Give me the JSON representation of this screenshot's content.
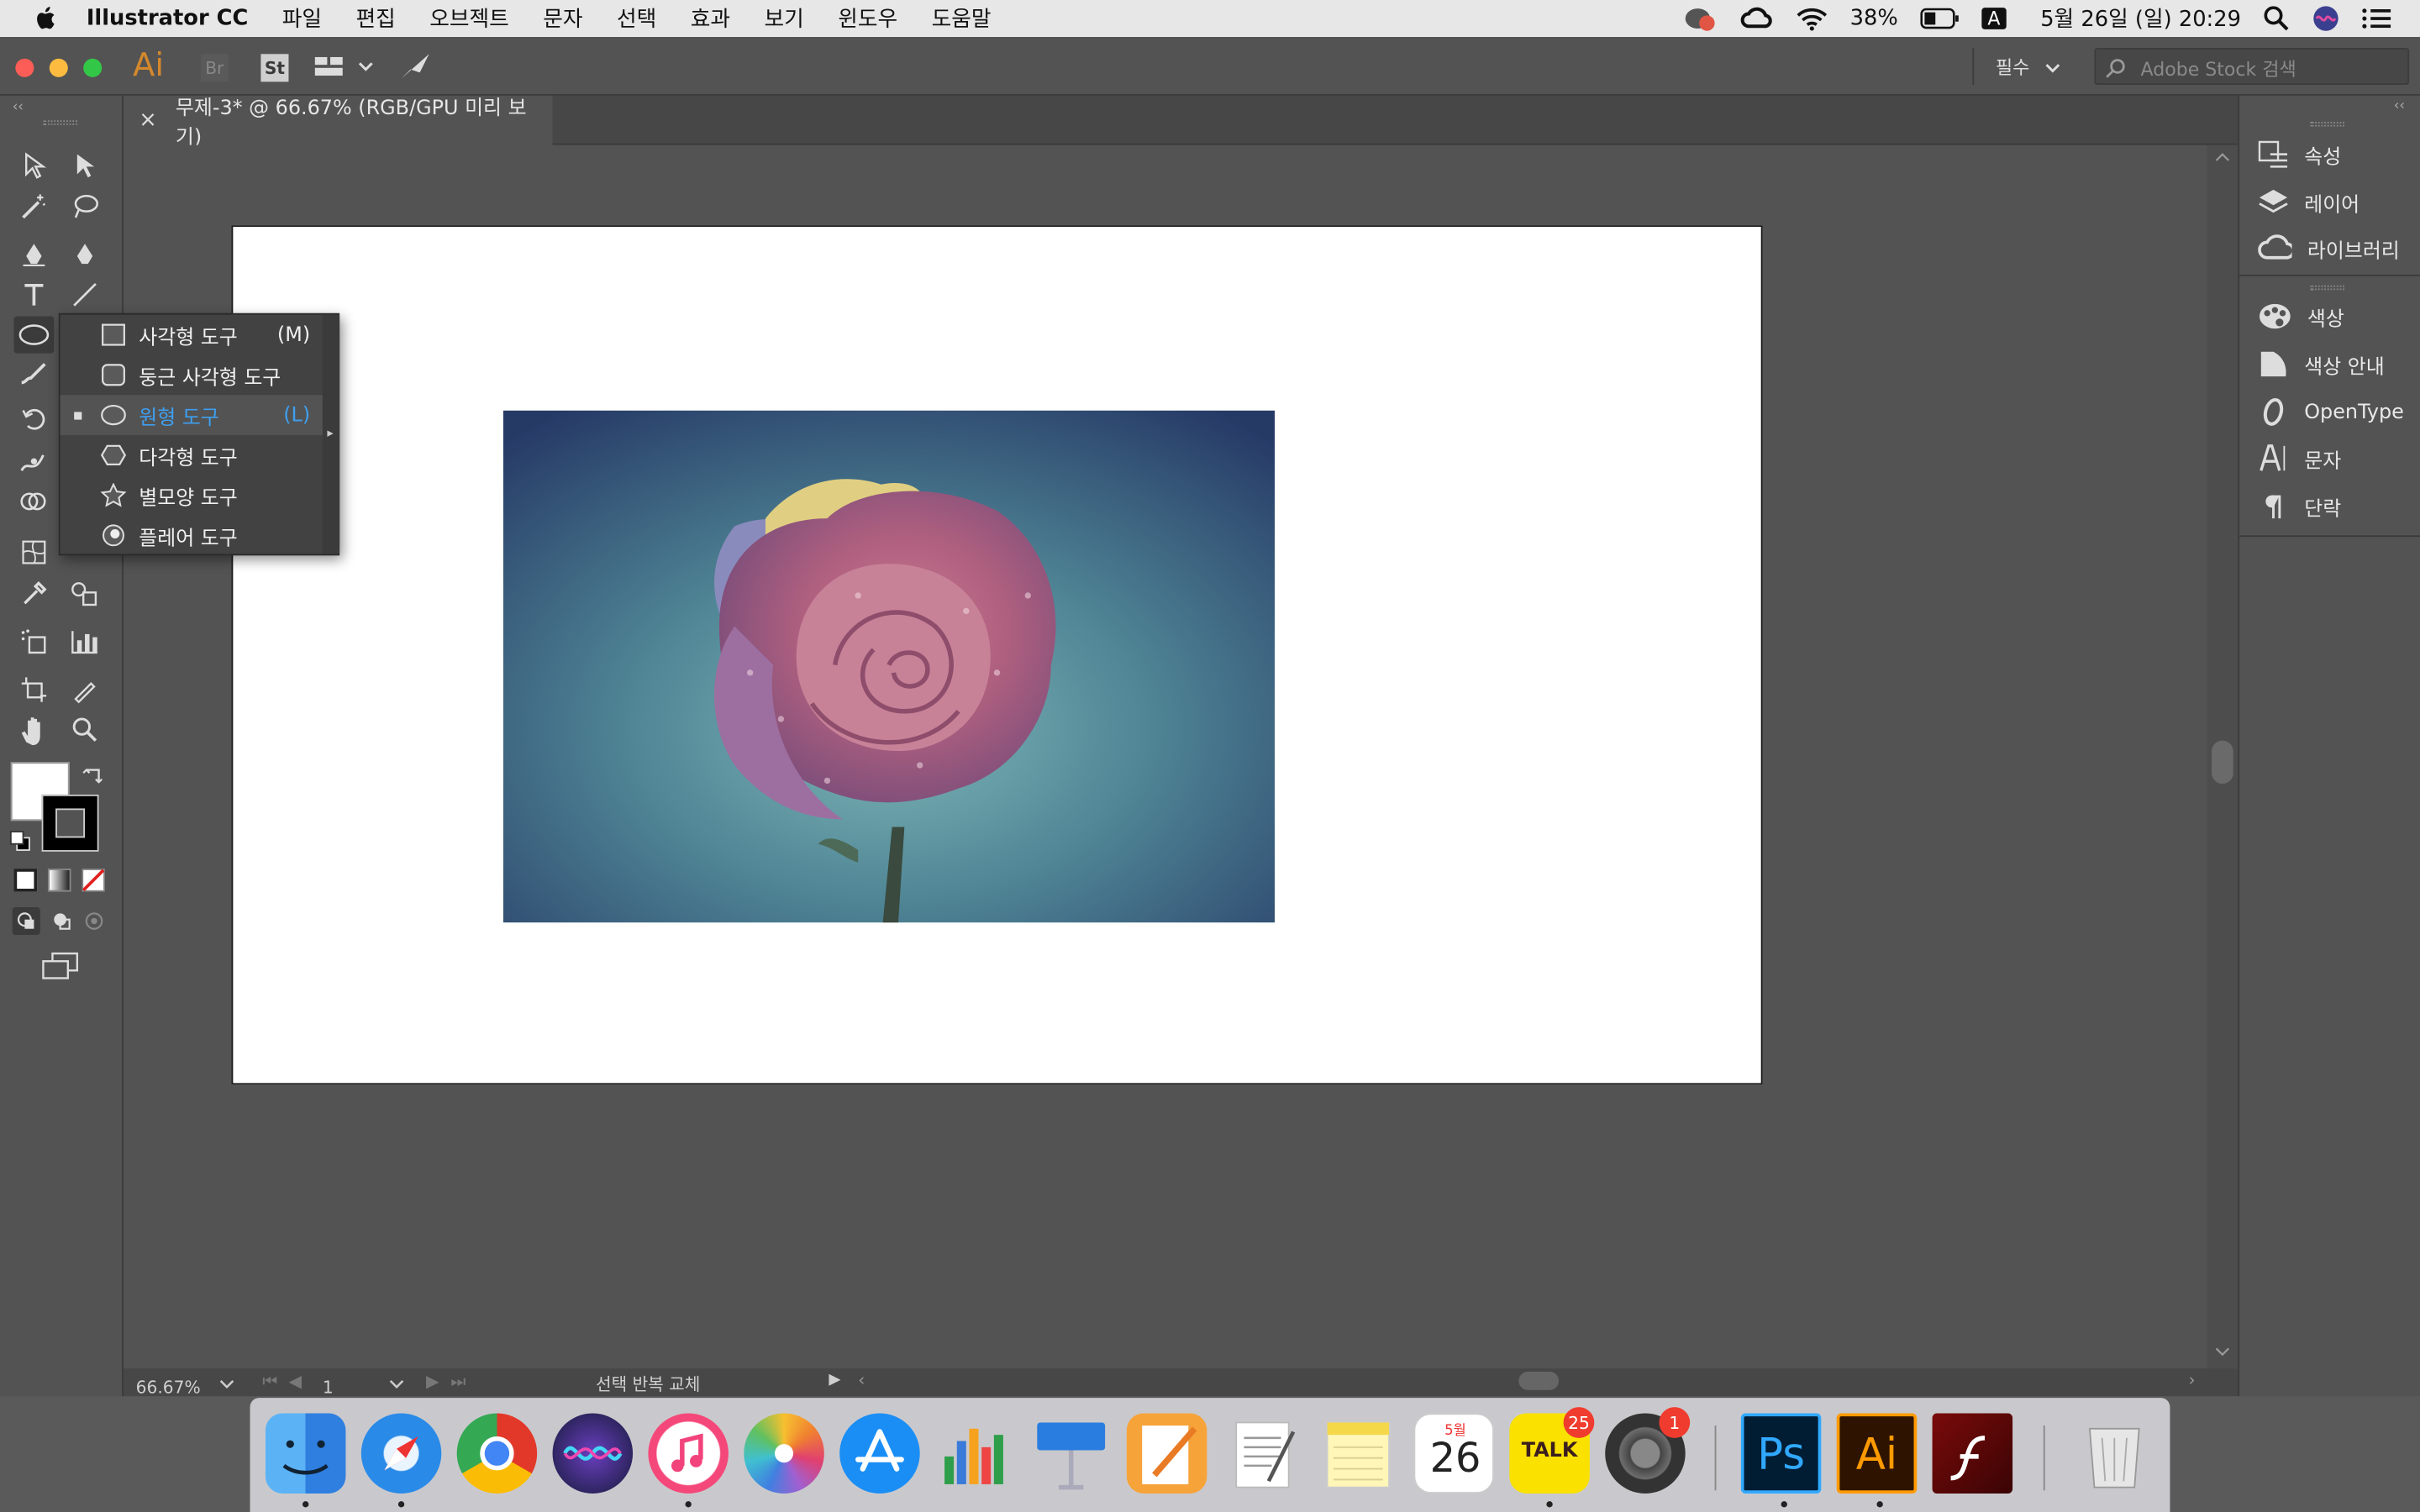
{
  "menubar": {
    "app_name": "Illustrator CC",
    "items": [
      "파일",
      "편집",
      "오브젝트",
      "문자",
      "선택",
      "효과",
      "보기",
      "윈도우",
      "도움말"
    ],
    "battery": "38%",
    "input_method": "A",
    "datetime": "5월 26일 (일)  20:29"
  },
  "appbar": {
    "workspace": "필수",
    "stock_search_placeholder": "Adobe Stock 검색",
    "ai_badge": "Ai",
    "br_badge": "Br",
    "st_badge": "St"
  },
  "document": {
    "tab_title": "무제-3* @ 66.67% (RGB/GPU 미리 보기)"
  },
  "flyout": [
    {
      "label": "사각형 도구",
      "shortcut": "(M)",
      "icon": "rectangle-icon",
      "selected": false
    },
    {
      "label": "둥근 사각형 도구",
      "shortcut": "",
      "icon": "rounded-rectangle-icon",
      "selected": false
    },
    {
      "label": "원형 도구",
      "shortcut": "(L)",
      "icon": "ellipse-icon",
      "selected": true
    },
    {
      "label": "다각형 도구",
      "shortcut": "",
      "icon": "polygon-icon",
      "selected": false
    },
    {
      "label": "별모양 도구",
      "shortcut": "",
      "icon": "star-icon",
      "selected": false
    },
    {
      "label": "플레어 도구",
      "shortcut": "",
      "icon": "flare-icon",
      "selected": false
    }
  ],
  "panels": {
    "group1": [
      "속성",
      "레이어",
      "라이브러리"
    ],
    "group2": [
      "색상",
      "색상 안내",
      "OpenType",
      "문자",
      "단락"
    ]
  },
  "statusbar": {
    "zoom": "66.67%",
    "artboard_number": "1",
    "info": "선택 반복 교체"
  },
  "dock": {
    "kakao_badge": "25",
    "prefs_badge": "1",
    "calendar_month": "5월",
    "calendar_day": "26",
    "kakao_label": "TALK",
    "ps_label": "Ps",
    "ai_label": "Ai"
  },
  "colors": {
    "accent": "#3e9ff0",
    "panel": "#535353",
    "dark": "#474747"
  }
}
